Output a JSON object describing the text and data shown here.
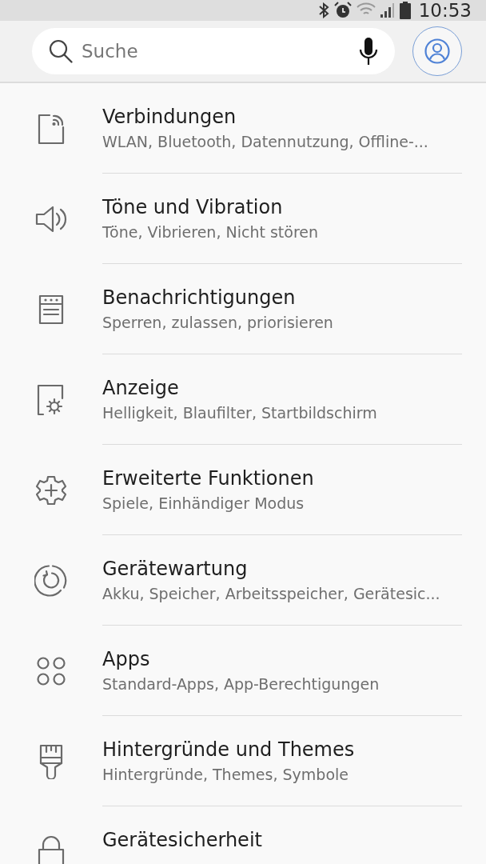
{
  "status_bar": {
    "time": "10:53"
  },
  "search": {
    "placeholder": "Suche"
  },
  "items": [
    {
      "kind": "connections",
      "title": "Verbindungen",
      "subtitle": "WLAN, Bluetooth, Datennutzung, Offline-..."
    },
    {
      "kind": "sound",
      "title": "Töne und Vibration",
      "subtitle": "Töne, Vibrieren, Nicht stören"
    },
    {
      "kind": "notifications",
      "title": "Benachrichtigungen",
      "subtitle": "Sperren, zulassen, priorisieren"
    },
    {
      "kind": "display",
      "title": "Anzeige",
      "subtitle": "Helligkeit, Blaufilter, Startbildschirm"
    },
    {
      "kind": "advanced",
      "title": "Erweiterte Funktionen",
      "subtitle": "Spiele, Einhändiger Modus"
    },
    {
      "kind": "maintenance",
      "title": "Gerätewartung",
      "subtitle": "Akku, Speicher, Arbeitsspeicher, Gerätesic..."
    },
    {
      "kind": "apps",
      "title": "Apps",
      "subtitle": "Standard-Apps, App-Berechtigungen"
    },
    {
      "kind": "themes",
      "title": "Hintergründe und Themes",
      "subtitle": "Hintergründe, Themes, Symbole"
    },
    {
      "kind": "security",
      "title": "Gerätesicherheit"
    }
  ]
}
